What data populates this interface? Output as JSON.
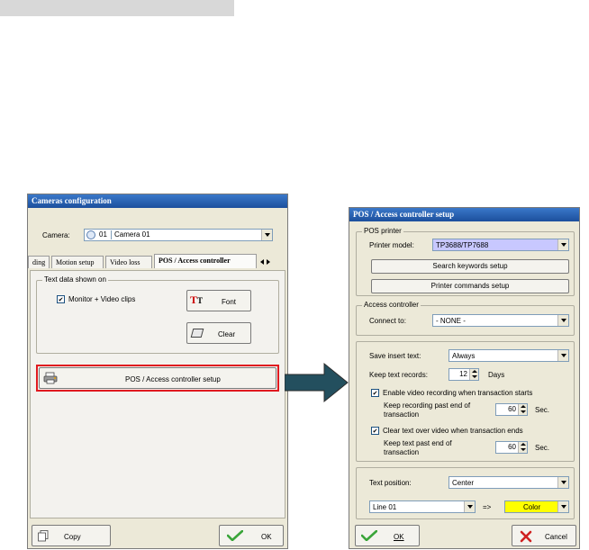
{
  "left_window": {
    "title": "Cameras configuration",
    "camera_label": "Camera:",
    "camera_number": "01",
    "camera_name": "Camera 01",
    "tabs": [
      "ding",
      "Motion setup",
      "Video loss",
      "POS / Access controller"
    ],
    "group_text_data": "Text data shown on",
    "monitor_checkbox": "Monitor + Video clips",
    "font_button": "Font",
    "clear_button": "Clear",
    "setup_button": "POS / Access controller setup",
    "copy_button": "Copy",
    "ok_button": "OK"
  },
  "right_window": {
    "title": "POS / Access controller setup",
    "pos_printer_group": "POS printer",
    "printer_model_label": "Printer model:",
    "printer_model_value": "TP3688/TP7688",
    "search_keywords_button": "Search keywords setup",
    "printer_commands_button": "Printer commands setup",
    "access_controller_group": "Access controller",
    "connect_to_label": "Connect to:",
    "connect_to_value": "- NONE -",
    "save_insert_text_label": "Save insert text:",
    "save_insert_text_value": "Always",
    "keep_text_records_label": "Keep text records:",
    "keep_text_records_value": "12",
    "days_label": "Days",
    "enable_video_recording": "Enable video recording when transaction starts",
    "keep_recording_label_1": "Keep recording past end of",
    "keep_recording_label_2": "transaction",
    "keep_recording_value": "60",
    "sec_label_1": "Sec.",
    "clear_text_overlay": "Clear text over video when transaction ends",
    "keep_text_label_1": "Keep text past end of",
    "keep_text_label_2": "transaction",
    "keep_text_value": "60",
    "sec_label_2": "Sec.",
    "text_position_label": "Text position:",
    "text_position_value": "Center",
    "line_value": "Line 01",
    "arrow_text": "=>",
    "color_value": "Color",
    "ok_button": "OK",
    "cancel_button": "Cancel"
  },
  "colors": {
    "title_bar": "#1c4f9c",
    "highlight_border": "#e0191f",
    "printer_model_bg": "#c8c8ff",
    "color_swatch": "#ffff00",
    "arrow": "#234f5e"
  }
}
